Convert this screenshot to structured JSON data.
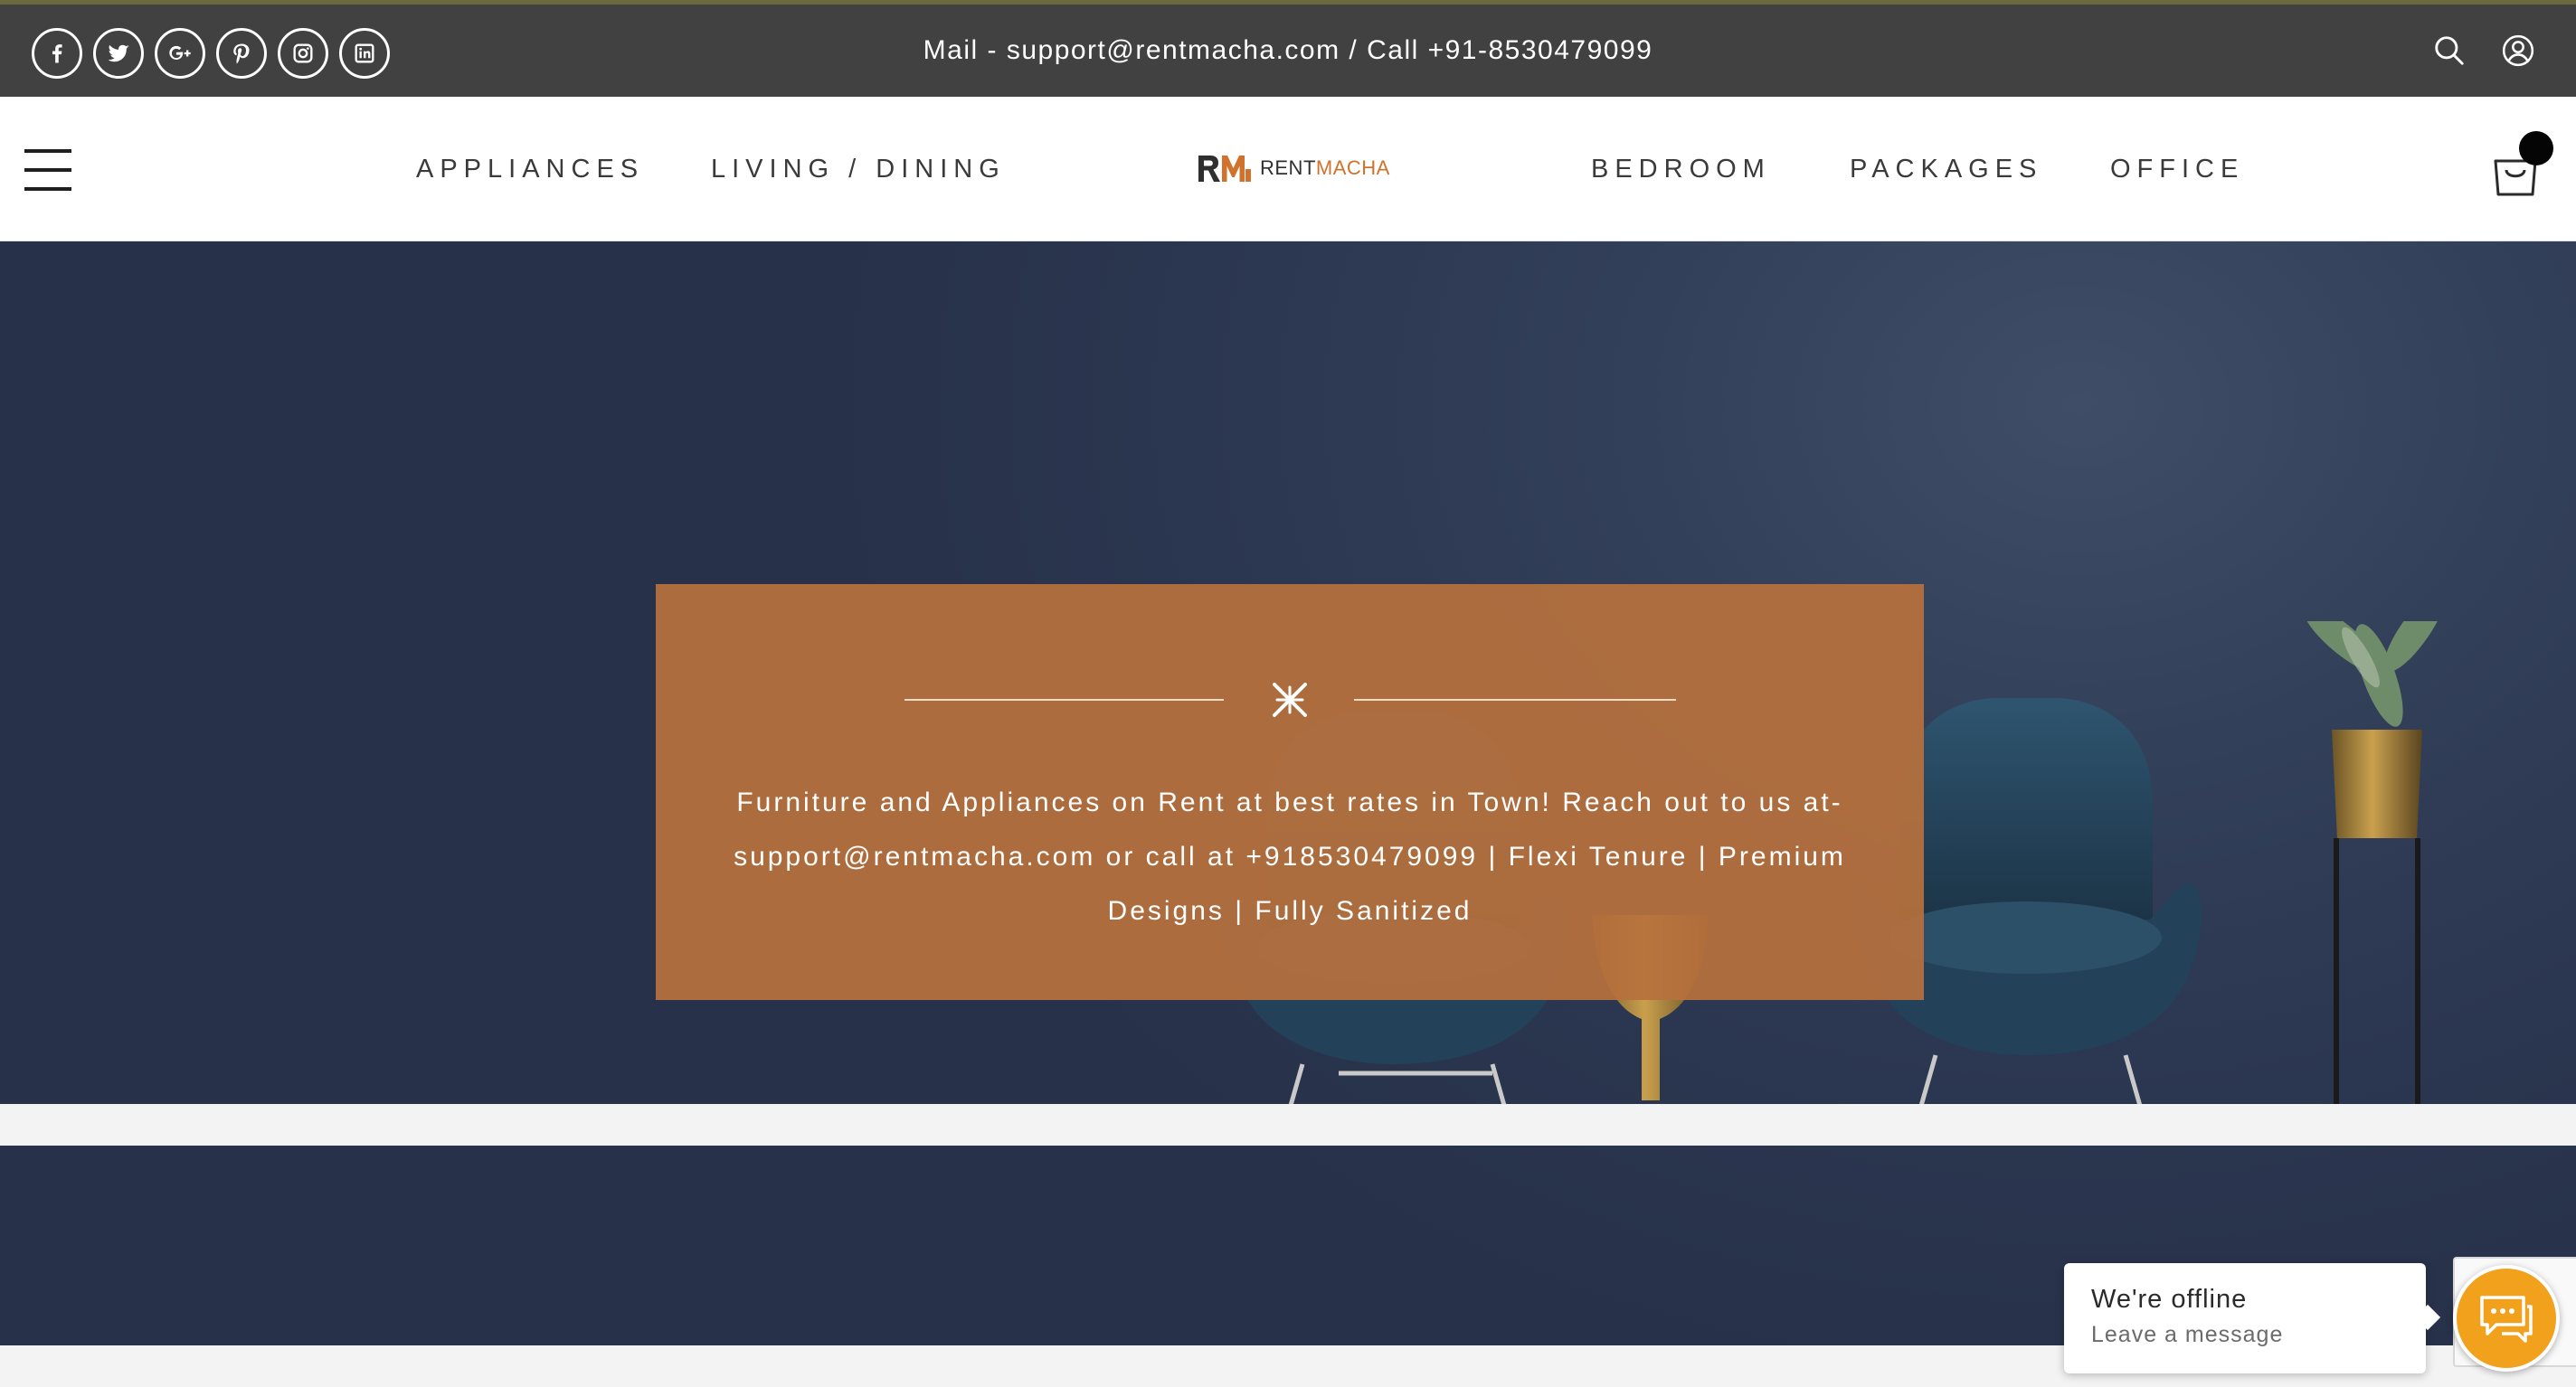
{
  "topbar": {
    "social_icons": [
      "facebook-icon",
      "twitter-icon",
      "google-plus-icon",
      "pinterest-icon",
      "instagram-icon",
      "linkedin-icon"
    ],
    "contact_text": "Mail - support@rentmacha.com / Call +91-8530479099",
    "right_icons": [
      "search-icon",
      "user-icon"
    ]
  },
  "nav": {
    "links": [
      "APPLIANCES",
      "LIVING / DINING",
      "BEDROOM",
      "PACKAGES",
      "OFFICE"
    ],
    "logo": {
      "text_dark": "RENT",
      "text_accent": "MACHA"
    },
    "cart_icon": "cart-icon"
  },
  "hero": {
    "banner_text": "Furniture and Appliances on Rent at best rates in Town! Reach out to us at- support@rentmacha.com or call at +918530479099 | Flexi Tenure | Premium Designs | Fully Sanitized"
  },
  "chat": {
    "title": "We're offline",
    "subtitle": "Leave a message",
    "icon": "chat-bubble-icon"
  },
  "colors": {
    "topbar_bg": "#414141",
    "banner_bg": "#b7713d",
    "logo_accent": "#d0722c",
    "chat_button": "#f2a11d"
  }
}
